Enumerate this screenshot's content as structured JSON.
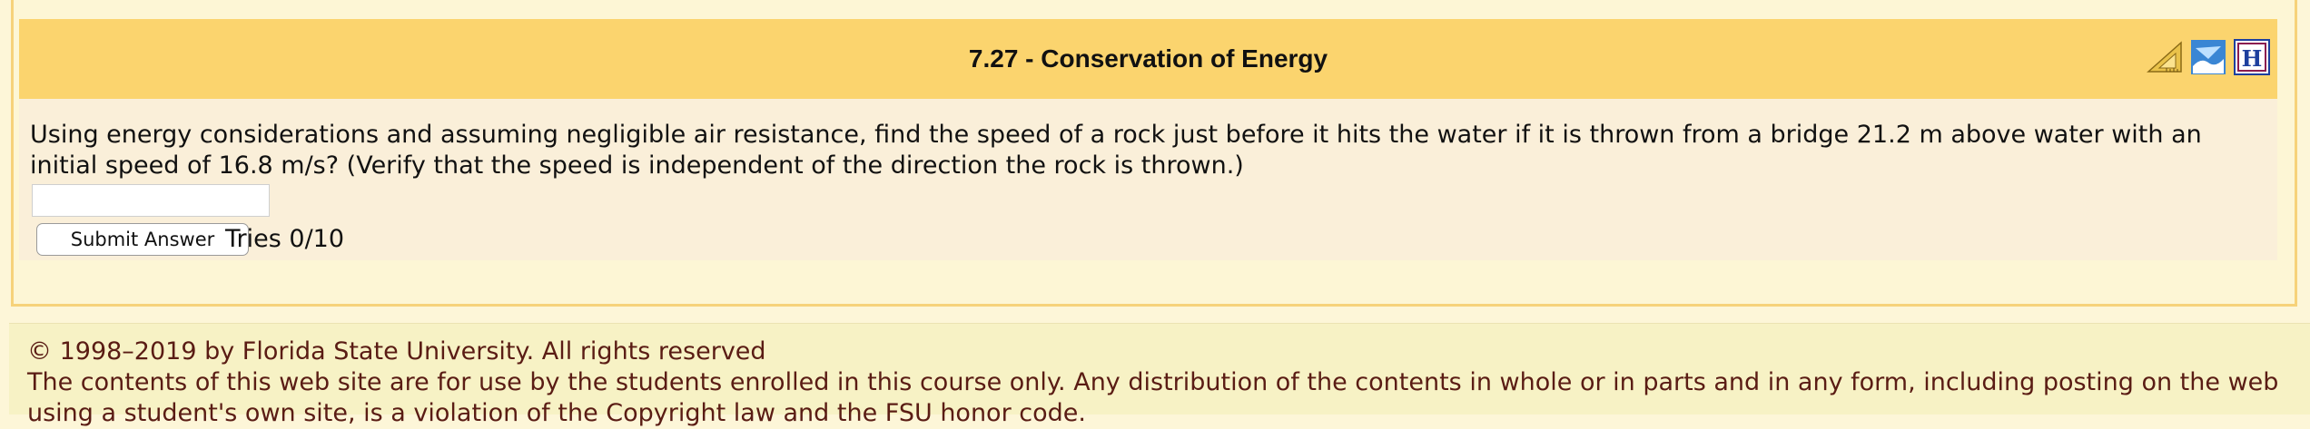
{
  "problem": {
    "title": "7.27 - Conservation of Energy",
    "icons": [
      "sketch-ruler-icon",
      "feedback-icon",
      "help-icon"
    ],
    "question": "Using energy considerations and assuming negligible air resistance, find the speed of a rock just before it hits the water if it is thrown from a bridge 21.2 m above water with an initial speed of 16.8 m/s? (Verify that the speed is independent of the direction the rock is thrown.)",
    "answer_value": "",
    "submit_label": "Submit Answer",
    "tries": "Tries 0/10"
  },
  "footer": {
    "copyright": "© 1998–2019 by Florida State University. All rights reserved",
    "notice": "The contents of this web site are for use by the students enrolled in this course only. Any distribution of the contents in whole or in parts and in any form, including posting on the web using a student's own site, is a violation of the Copyright law and the FSU honor code."
  },
  "colors": {
    "header": "#fbd46e",
    "footer_text": "#5a1c14",
    "footer_bg": "#f7f2c5"
  }
}
